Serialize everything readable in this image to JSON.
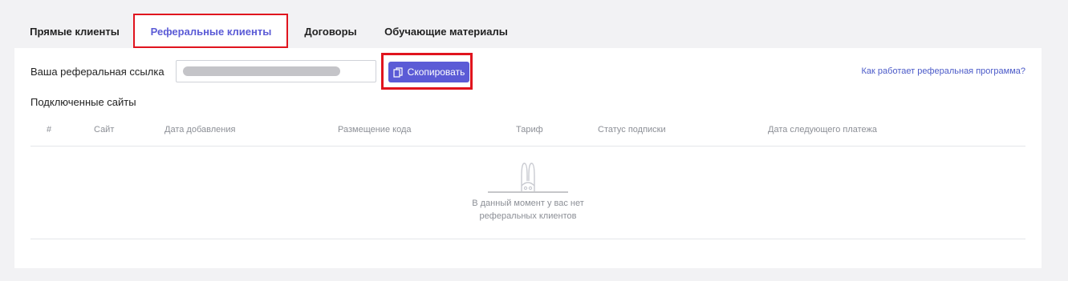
{
  "tabs": [
    {
      "label": "Прямые клиенты",
      "active": false
    },
    {
      "label": "Реферальные клиенты",
      "active": true
    },
    {
      "label": "Договоры",
      "active": false
    },
    {
      "label": "Обучающие материалы",
      "active": false
    }
  ],
  "referral": {
    "label": "Ваша реферальная ссылка",
    "copy_button": "Скопировать",
    "how_link": "Как работает реферальная программа?"
  },
  "sites": {
    "title": "Подключенные сайты",
    "columns": [
      "#",
      "Сайт",
      "Дата добавления",
      "Размещение кода",
      "Тариф",
      "Статус подписки",
      "Дата следующего платежа"
    ],
    "rows": [],
    "empty_line1": "В данный момент у вас нет",
    "empty_line2": "реферальных клиентов"
  },
  "colors": {
    "accent": "#5b5bd6",
    "highlight": "#e0141e",
    "link": "#4b5ac8",
    "background": "#f2f2f4"
  },
  "icons": [
    "copy-icon",
    "bunny-icon"
  ]
}
